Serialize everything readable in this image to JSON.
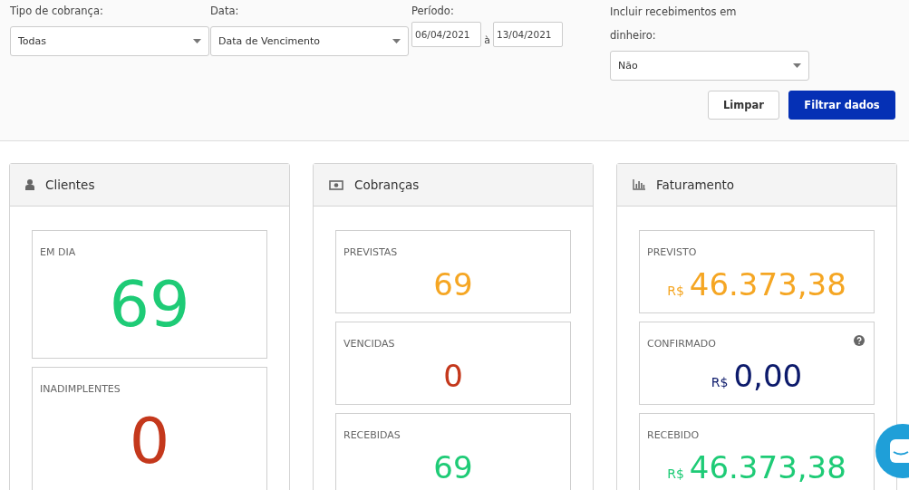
{
  "filters": {
    "charge_type": {
      "label": "Tipo de cobrança:",
      "value": "Todas"
    },
    "date": {
      "label": "Data:",
      "value": "Data de Vencimento"
    },
    "period": {
      "label": "Período:",
      "from": "06/04/2021",
      "separator": "à",
      "to": "13/04/2021"
    },
    "cash": {
      "label": "Incluir recebimentos em dinheiro:",
      "value": "Não"
    },
    "buttons": [
      {
        "label": "Limpar",
        "kind": "secondary"
      },
      {
        "label": "Filtrar dados",
        "kind": "primary"
      }
    ]
  },
  "cards": [
    {
      "title": "Clientes",
      "tiles": [
        {
          "label": "EM DIA",
          "value": "69",
          "color": "#1ecb76",
          "help": false
        },
        {
          "label": "INADIMPLENTES",
          "value": "0",
          "color": "#c4381c",
          "help": false
        }
      ]
    },
    {
      "title": "Cobranças",
      "tiles": [
        {
          "label": "PREVISTAS",
          "value": "69",
          "color": "#f5a623",
          "help": false
        },
        {
          "label": "VENCIDAS",
          "value": "0",
          "color": "#c4381c",
          "help": false
        },
        {
          "label": "RECEBIDAS",
          "value": "69",
          "color": "#1ecb76",
          "help": false
        }
      ]
    },
    {
      "title": "Faturamento",
      "tiles": [
        {
          "label": "PREVISTO",
          "currency": "R$",
          "value": "46.373,38",
          "color": "#f5a623",
          "help": false
        },
        {
          "label": "CONFIRMADO",
          "currency": "R$",
          "value": "0,00",
          "color": "#0c1a6b",
          "help": true
        },
        {
          "label": "RECEBIDO",
          "currency": "R$",
          "value": "46.373,38",
          "color": "#1ecb76",
          "help": false
        }
      ]
    }
  ]
}
